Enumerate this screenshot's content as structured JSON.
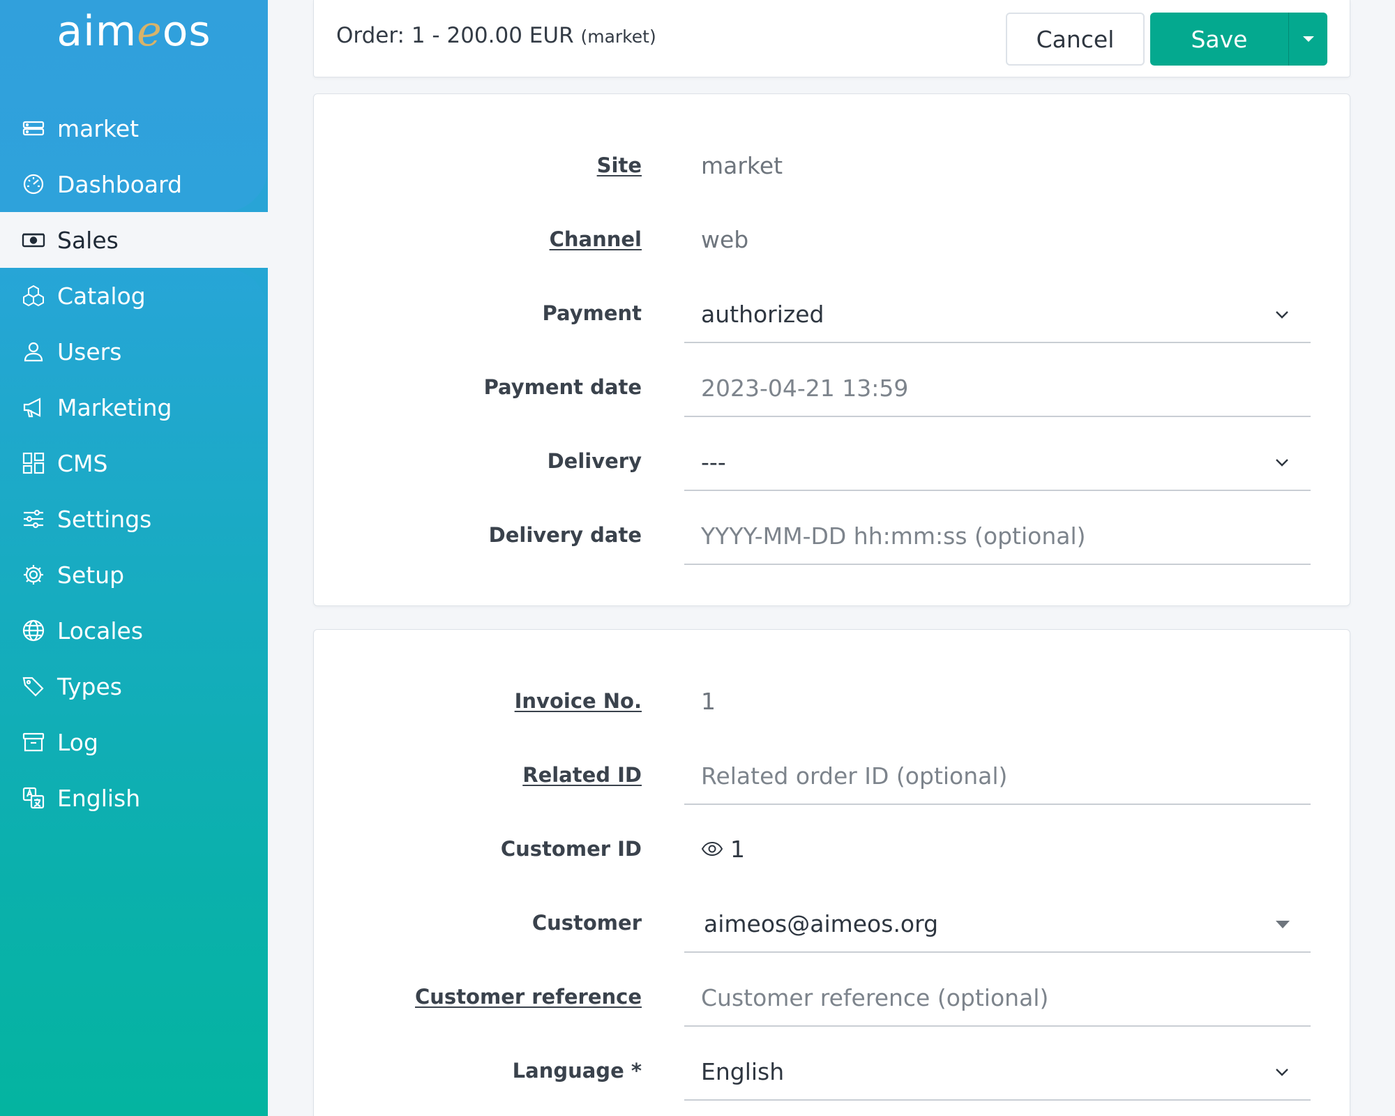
{
  "brand": {
    "name_pre": "aim",
    "name_e": "e",
    "name_post": "os"
  },
  "sidebar": {
    "items": [
      {
        "label": "market",
        "icon": "server-icon"
      },
      {
        "label": "Dashboard",
        "icon": "gauge-icon"
      },
      {
        "label": "Sales",
        "icon": "cash-icon",
        "active": true
      },
      {
        "label": "Catalog",
        "icon": "boxes-icon"
      },
      {
        "label": "Users",
        "icon": "person-icon"
      },
      {
        "label": "Marketing",
        "icon": "megaphone-icon"
      },
      {
        "label": "CMS",
        "icon": "layout-icon"
      },
      {
        "label": "Settings",
        "icon": "sliders-icon"
      },
      {
        "label": "Setup",
        "icon": "gear-icon"
      },
      {
        "label": "Locales",
        "icon": "globe-icon"
      },
      {
        "label": "Types",
        "icon": "tags-icon"
      },
      {
        "label": "Log",
        "icon": "archive-icon"
      },
      {
        "label": "English",
        "icon": "translate-icon"
      }
    ]
  },
  "header": {
    "title": "Order: 1 - 200.00 EUR",
    "site": "(market)",
    "cancel_label": "Cancel",
    "save_label": "Save"
  },
  "order": {
    "site": {
      "label": "Site",
      "value": "market"
    },
    "channel": {
      "label": "Channel",
      "value": "web"
    },
    "payment": {
      "label": "Payment",
      "value": "authorized"
    },
    "payment_date": {
      "label": "Payment date",
      "value": "2023-04-21 13:59"
    },
    "delivery": {
      "label": "Delivery",
      "value": "---"
    },
    "delivery_date": {
      "label": "Delivery date",
      "placeholder": "YYYY-MM-DD hh:mm:ss (optional)"
    }
  },
  "invoice": {
    "invoice_no": {
      "label": "Invoice No.",
      "value": "1"
    },
    "related_id": {
      "label": "Related ID",
      "placeholder": "Related order ID (optional)"
    },
    "customer_id": {
      "label": "Customer ID",
      "value": "1"
    },
    "customer": {
      "label": "Customer",
      "value": "aimeos@aimeos.org"
    },
    "customer_reference": {
      "label": "Customer reference",
      "placeholder": "Customer reference (optional)"
    },
    "language": {
      "label": "Language *",
      "value": "English"
    }
  },
  "colors": {
    "sidebar_top": "#31a0dc",
    "sidebar_bottom": "#04b4a0",
    "primary_button": "#04a98f",
    "page_background": "#f4f6f9"
  }
}
